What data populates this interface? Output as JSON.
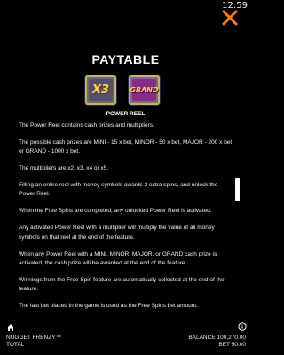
{
  "status_bar": {
    "time": "12:59"
  },
  "header": {
    "title": "PAYTABLE",
    "close_icon": "close-x-icon"
  },
  "symbols": [
    {
      "name": "x3-multiplier",
      "label": "X3"
    },
    {
      "name": "grand-prize",
      "label": "GRAND"
    }
  ],
  "section": {
    "title": "POWER REEL",
    "paragraphs": [
      "The Power Reel contains cash prizes and multipliers.",
      "The possible cash prizes are MINI - 15 x bet, MINOR - 50 x bet, MAJOR - 200 x bet or GRAND - 1000 x bet.",
      "The multipliers are x2, x3, x4 or x5.",
      "Filling an entire reel with money symbols awards 2 extra spins, and unlock the Power Reel.",
      "When the Free Spins are completed, any unlocked Power Reel is activated.",
      "Any activated Power Reel with a multiplier will multiply the value of all money symbols on that reel at the end of the feature.",
      "When any Power Reel with a MINI, MINOR, MAJOR, or GRAND cash prize is activated, the cash prize will be awarded at the end of the feature.",
      "Winnings from the Free Spin feature are automatically collected at the end of the feature.",
      "The last bet placed in the game is used as the Free Spins bet amount."
    ]
  },
  "footer": {
    "game_name": "NUGGET FRENZY™",
    "total_label": "TOTAL",
    "balance": "BALANCE 100,270.00",
    "bet": "BET 50.00",
    "home_icon": "home-icon",
    "info_icon": "info-icon"
  },
  "colors": {
    "background": "#000000",
    "accent": "#ff7a1a",
    "text": "#ffffff"
  }
}
